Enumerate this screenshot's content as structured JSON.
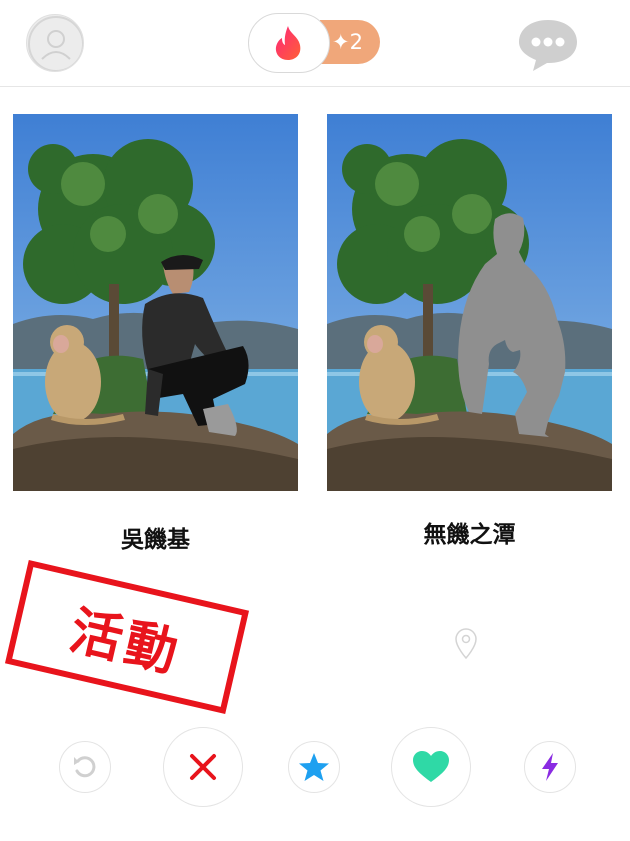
{
  "header": {
    "logo_badge": "✦2",
    "avatar_icon": "avatar-icon",
    "chat_icon": "chat-bubble-icon"
  },
  "cards": [
    {
      "name": "吳饑基"
    },
    {
      "name": "無饑之潭"
    }
  ],
  "stamp": {
    "text": "活動"
  },
  "actions": [
    "rewind",
    "nope",
    "super-like",
    "like",
    "boost"
  ],
  "colors": {
    "brand_gradient_start": "#fd267a",
    "brand_gradient_end": "#ff6036",
    "badge": "#f0a77a",
    "nope": "#e8141c",
    "super_like": "#1ea0f0",
    "like": "#2fd9a6",
    "boost": "#8a2be2",
    "stamp": "#e8141c"
  }
}
